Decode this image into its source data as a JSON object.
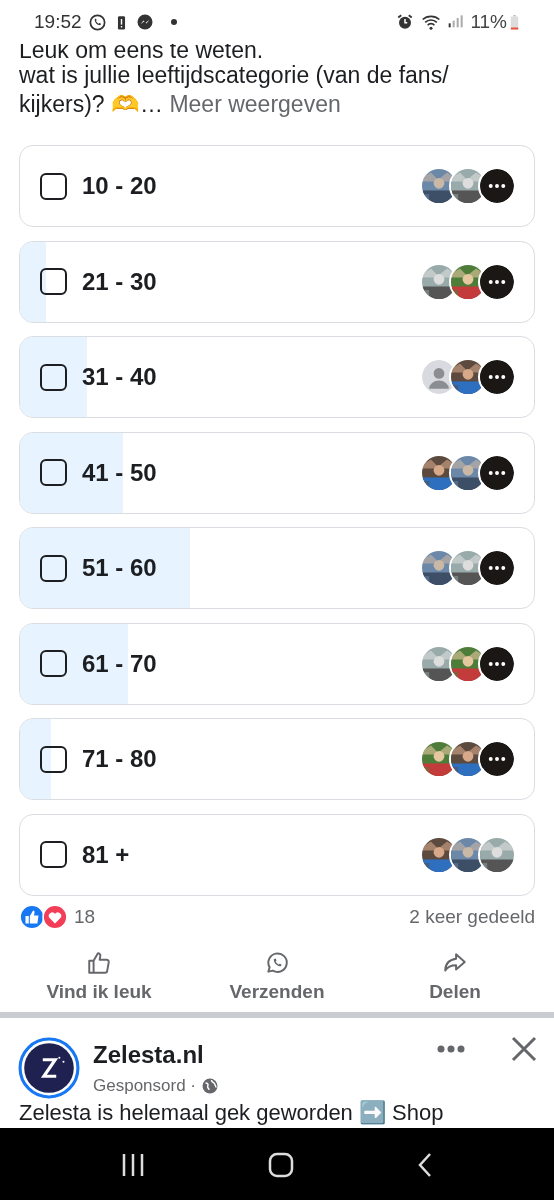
{
  "status_bar": {
    "time": "19:52",
    "battery": "11%"
  },
  "post": {
    "cut_line": "Leuk om eens te weten.",
    "text": "wat is jullie leeftijdscategorie (van de fans/ kijkers)? 🫶…",
    "more_link": "Meer weergeven"
  },
  "poll_options": [
    {
      "label": "10 - 20",
      "checked": false,
      "level": 0,
      "voters": [
        {
          "kind": "picture"
        },
        {
          "kind": "picture"
        }
      ],
      "more": true
    },
    {
      "label": "21 - 30",
      "checked": false,
      "level": 0.05,
      "voters": [
        {
          "kind": "picture"
        },
        {
          "kind": "picture"
        }
      ],
      "more": true
    },
    {
      "label": "31 - 40",
      "checked": false,
      "level": 0.13,
      "voters": [
        {
          "kind": "silhouette"
        },
        {
          "kind": "picture"
        }
      ],
      "more": true
    },
    {
      "label": "41 - 50",
      "checked": false,
      "level": 0.2,
      "voters": [
        {
          "kind": "picture"
        },
        {
          "kind": "picture"
        }
      ],
      "more": true
    },
    {
      "label": "51 - 60",
      "checked": false,
      "level": 0.33,
      "voters": [
        {
          "kind": "picture"
        },
        {
          "kind": "picture"
        }
      ],
      "more": true
    },
    {
      "label": "61 - 70",
      "checked": false,
      "level": 0.21,
      "voters": [
        {
          "kind": "picture"
        },
        {
          "kind": "picture"
        }
      ],
      "more": true
    },
    {
      "label": "71 - 80",
      "checked": false,
      "level": 0.06,
      "voters": [
        {
          "kind": "picture"
        },
        {
          "kind": "picture"
        }
      ],
      "more": true
    },
    {
      "label": "81 +",
      "checked": false,
      "level": 0,
      "voters": [
        {
          "kind": "picture"
        },
        {
          "kind": "picture"
        },
        {
          "kind": "picture"
        }
      ],
      "more": false
    }
  ],
  "reactions": {
    "count": "18",
    "shares": "2 keer gedeeld"
  },
  "actions": [
    {
      "kind": "like",
      "label": "Vind ik leuk"
    },
    {
      "kind": "whatsapp",
      "label": "Verzenden"
    },
    {
      "kind": "share",
      "label": "Delen"
    }
  ],
  "ad": {
    "name": "Zelesta.nl",
    "sponsored": "Gesponsord ·",
    "cut_line": "Zelesta is helemaal gek geworden ➡️ Shop"
  }
}
